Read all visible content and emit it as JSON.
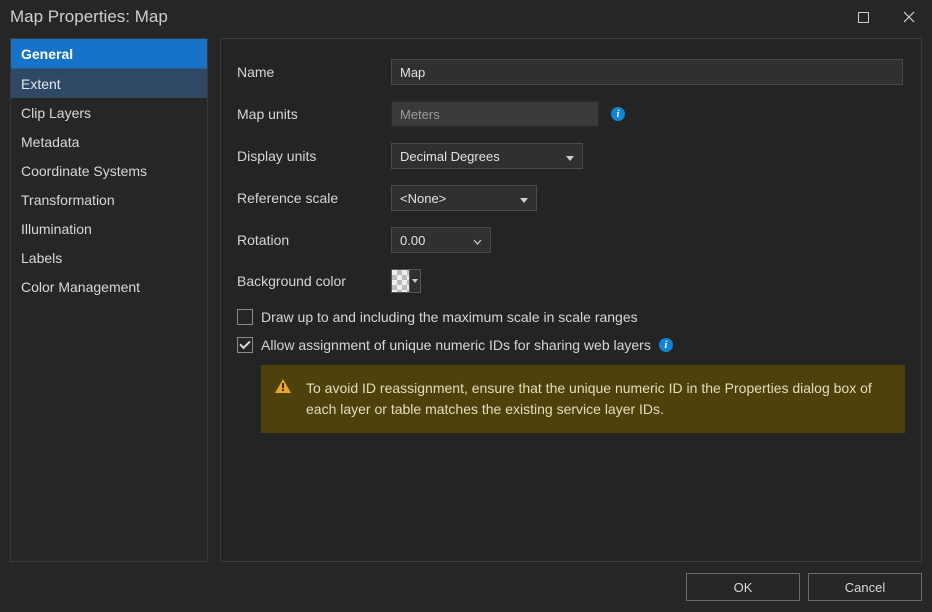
{
  "window": {
    "title": "Map Properties: Map"
  },
  "sidebar": {
    "items": [
      {
        "label": "General",
        "state": "active"
      },
      {
        "label": "Extent",
        "state": "hover"
      },
      {
        "label": "Clip Layers",
        "state": ""
      },
      {
        "label": "Metadata",
        "state": ""
      },
      {
        "label": "Coordinate Systems",
        "state": ""
      },
      {
        "label": "Transformation",
        "state": ""
      },
      {
        "label": "Illumination",
        "state": ""
      },
      {
        "label": "Labels",
        "state": ""
      },
      {
        "label": "Color Management",
        "state": ""
      }
    ]
  },
  "form": {
    "name_label": "Name",
    "name_value": "Map",
    "map_units_label": "Map units",
    "map_units_value": "Meters",
    "display_units_label": "Display units",
    "display_units_value": "Decimal Degrees",
    "reference_scale_label": "Reference scale",
    "reference_scale_value": "<None>",
    "rotation_label": "Rotation",
    "rotation_value": "0.00",
    "background_label": "Background color",
    "draw_max_scale_label": "Draw up to and including the maximum scale in scale ranges",
    "draw_max_scale_checked": false,
    "allow_ids_label": "Allow assignment of unique numeric IDs for sharing web layers",
    "allow_ids_checked": true,
    "warning_text": "To avoid ID reassignment, ensure that the unique numeric ID in the Properties dialog box of each layer or table matches the existing service layer IDs."
  },
  "footer": {
    "ok": "OK",
    "cancel": "Cancel"
  }
}
